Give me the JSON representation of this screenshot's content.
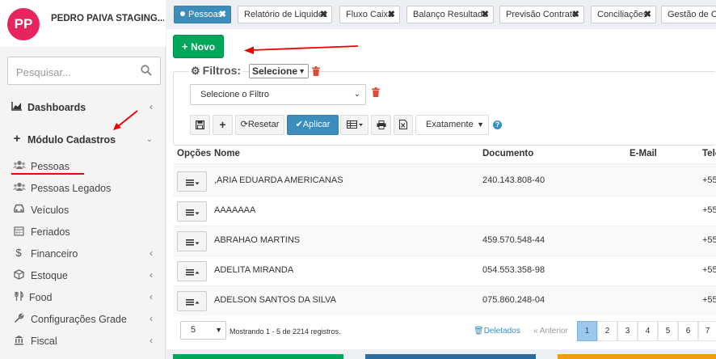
{
  "brand": {
    "initials": "PP",
    "name": "PEDRO PAIVA STAGING..."
  },
  "search": {
    "placeholder": "Pesquisar..."
  },
  "sidebar": {
    "items": [
      {
        "label": "Dashboards",
        "icon": "area-chart-icon"
      },
      {
        "label": "Módulo Cadastros",
        "icon": "plus-icon"
      },
      {
        "label": "Pessoas",
        "icon": "users-icon"
      },
      {
        "label": "Pessoas Legados",
        "icon": "users-icon"
      },
      {
        "label": "Veículos",
        "icon": "car-icon"
      },
      {
        "label": "Feriados",
        "icon": "calendar-icon"
      },
      {
        "label": "Financeiro",
        "icon": "dollar-icon"
      },
      {
        "label": "Estoque",
        "icon": "cubes-icon"
      },
      {
        "label": "Food",
        "icon": "cutlery-icon"
      },
      {
        "label": "Configurações Grade",
        "icon": "wrench-icon"
      },
      {
        "label": "Fiscal",
        "icon": "bank-icon"
      }
    ]
  },
  "tabs": [
    {
      "label": "Pessoas",
      "active": true
    },
    {
      "label": "Relatório de Liquidez"
    },
    {
      "label": "Fluxo Caixa"
    },
    {
      "label": "Balanço Resultado"
    },
    {
      "label": "Previsão Contrato"
    },
    {
      "label": "Conciliações"
    },
    {
      "label": "Gestão de Con"
    }
  ],
  "toolbar": {
    "novo_label": "Novo",
    "filtros_label": "Filtros:",
    "filtros_select": "Selecione",
    "filter_select": "Selecione o Filtro",
    "reset_label": "Resetar",
    "apply_label": "Aplicar",
    "match_select": "Exatamente"
  },
  "table": {
    "columns": [
      "Opções",
      "Nome",
      "Documento",
      "E-Mail",
      "Tele"
    ],
    "rows": [
      {
        "nome": ",ARIA EDUARDA AMERICANAS",
        "documento": "240.143.808-40",
        "tel": "+55"
      },
      {
        "nome": "AAAAAAA",
        "documento": "",
        "tel": "+55"
      },
      {
        "nome": "ABRAHAO MARTINS",
        "documento": "459.570.548-44",
        "tel": "+55"
      },
      {
        "nome": "ADELITA MIRANDA",
        "documento": "054.553.358-98",
        "tel": "+55"
      },
      {
        "nome": "ADELSON SANTOS DA SILVA",
        "documento": "075.860.248-04",
        "tel": "+55"
      }
    ]
  },
  "footer": {
    "page_size": "5",
    "info": "Mostrando 1 - 5 de 2214 registros.",
    "deleted": "Deletados",
    "prev": "« Anterior",
    "pages": [
      "1",
      "2",
      "3",
      "4",
      "5",
      "6",
      "7"
    ],
    "current_page": "1"
  },
  "colors": {
    "brand": "#e8245e",
    "success": "#00a65a",
    "primary": "#3c8dbc",
    "annotation": "#e00000"
  }
}
